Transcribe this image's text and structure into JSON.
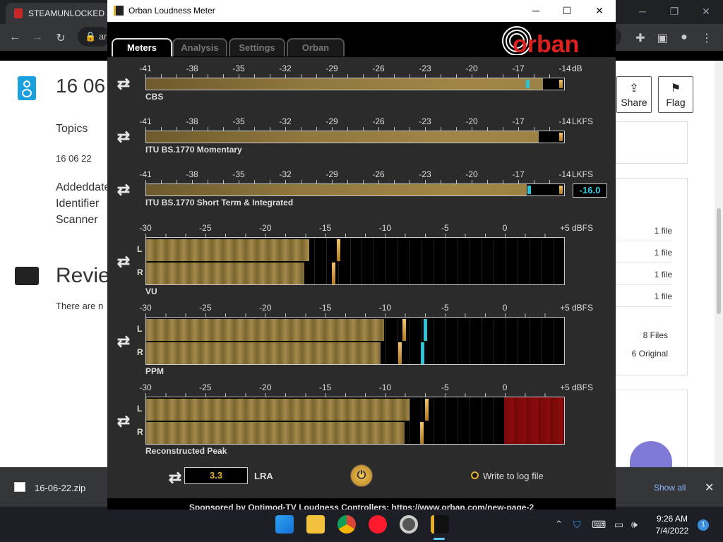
{
  "browser": {
    "tab_title": "STEAMUNLOCKED »",
    "omnibox_text": "ar",
    "page": {
      "title": "16 06",
      "topics_label": "Topics",
      "topics_value": "16 06 22",
      "meta_labels": [
        "Addeddate",
        "Identifier",
        "Scanner"
      ],
      "reviews_title": "Revie",
      "reviews_text": "There are n",
      "share_label": "Share",
      "flag_label": "Flag",
      "file_counts": [
        "1 file",
        "1 file",
        "1 file",
        "1 file"
      ],
      "files_total": "8 Files",
      "files_original": "6 Original"
    }
  },
  "downloads": {
    "file_name": "16-06-22.zip",
    "show_all": "Show all"
  },
  "taskbar": {
    "time": "9:26 AM",
    "date": "7/4/2022",
    "notification_count": "1"
  },
  "orban": {
    "title": "Orban Loudness Meter",
    "tabs": [
      "Meters",
      "Analysis",
      "Settings",
      "Orban"
    ],
    "active_tab": 0,
    "logo_text": "orban",
    "scale_loud": [
      "-41",
      "-38",
      "-35",
      "-32",
      "-29",
      "-26",
      "-23",
      "-20",
      "-17",
      "-14"
    ],
    "scale_dbfs": [
      "-30",
      "-25",
      "-20",
      "-15",
      "-10",
      "-5",
      "0",
      "+5"
    ],
    "meters": [
      {
        "label": "CBS",
        "unit": "dB",
        "fill": 0.95,
        "marker": 0.912
      },
      {
        "label": "ITU BS.1770 Momentary",
        "unit": "LKFS",
        "fill": 0.94,
        "marker": null
      },
      {
        "label": "ITU BS.1770 Short Term & Integrated",
        "unit": "LKFS",
        "fill": 0.91,
        "marker": 0.915,
        "value": "-16.0"
      }
    ],
    "stereo_meters": [
      {
        "label": "VU",
        "unit": "dBFS",
        "L_fill": 0.39,
        "R_fill": 0.378,
        "L_peak": 0.46,
        "R_peak": 0.448,
        "L_cyan": null,
        "R_cyan": null,
        "over": false
      },
      {
        "label": "PPM",
        "unit": "dBFS",
        "L_fill": 0.57,
        "R_fill": 0.56,
        "L_peak": 0.617,
        "R_peak": 0.606,
        "L_cyan": 0.667,
        "R_cyan": 0.66,
        "over": false
      },
      {
        "label": "Reconstructed Peak",
        "unit": "dBFS",
        "L_fill": 0.63,
        "R_fill": 0.618,
        "L_peak": 0.67,
        "R_peak": 0.658,
        "L_cyan": null,
        "R_cyan": null,
        "over": true
      }
    ],
    "channel_L": "L",
    "channel_R": "R",
    "lra_value": "3.3",
    "lra_label": "LRA",
    "log_label": "Write to log file",
    "footer_text": "Sponsored by Optimod-TV Loudness Controllers: https://www.orban.com/new-page-2"
  }
}
